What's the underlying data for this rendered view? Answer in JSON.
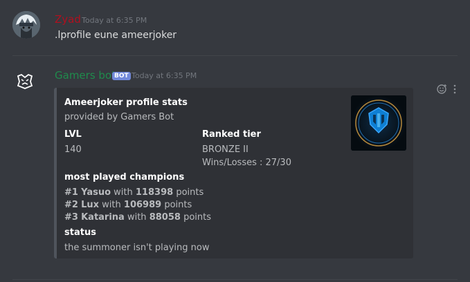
{
  "messages": [
    {
      "username": "Zyad",
      "username_color": "#b0101f",
      "timestamp": "Today at 6:35 PM",
      "text": ".lprofile eune ameerjoker"
    },
    {
      "username": "Gamers bot",
      "username_color": "#1f8b4c",
      "bot_tag": "BOT",
      "timestamp": "Today at 6:35 PM"
    }
  ],
  "embed": {
    "title": "Ameerjoker profile stats",
    "provider": "provided by Gamers Bot",
    "fields": {
      "lvl_label": "LVL",
      "lvl_value": "140",
      "ranked_label": "Ranked tier",
      "ranked_value": "BRONZE II",
      "winloss_value": "Wins/Losses : 27/30",
      "champions_label": "most played champions",
      "status_label": "status",
      "status_value": "the summoner isn't playing now"
    },
    "champions": [
      {
        "rank": "#1",
        "name": "Yasuo",
        "with": "with",
        "points": "118398",
        "suffix": "points"
      },
      {
        "rank": "#2",
        "name": "Lux",
        "with": "with",
        "points": "106989",
        "suffix": "points"
      },
      {
        "rank": "#3",
        "name": "Katarina",
        "with": "with",
        "points": "88058",
        "suffix": "points"
      }
    ],
    "thumbnail_icon": "league-emblem-icon"
  },
  "hover_actions": {
    "reaction_icon": "add-reaction-icon",
    "more_icon": "more-options-icon"
  }
}
